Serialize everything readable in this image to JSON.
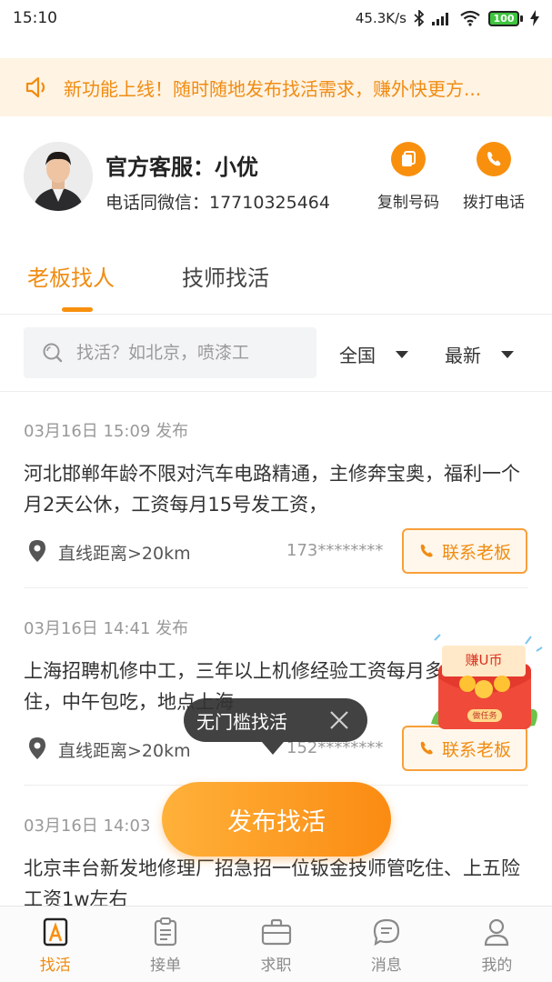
{
  "status_bar": {
    "time": "15:10",
    "net_speed": "45.3K/s",
    "battery": "100"
  },
  "notice": {
    "text": "新功能上线！随时随地发布找活需求，赚外快更方..."
  },
  "service": {
    "name": "官方客服：小优",
    "phone": "电话同微信：17710325464",
    "copy_label": "复制号码",
    "call_label": "拨打电话"
  },
  "tabs": [
    {
      "label": "老板找人",
      "active": true
    },
    {
      "label": "技师找活",
      "active": false
    }
  ],
  "search": {
    "placeholder": "找活？如北京，喷漆工",
    "region": "全国",
    "sort": "最新"
  },
  "jobs": [
    {
      "time": "03月16日 15:09 发布",
      "desc": "河北邯郸年龄不限对汽车电路精通，主修奔宝奥，福利一个月2天公休，工资每月15号发工资，",
      "distance": "直线距离>20km",
      "phone": "173********",
      "contact": "联系老板"
    },
    {
      "time": "03月16日 14:41 发布",
      "desc": "上海招聘机修中工，三年以上机修经验工资每月多6500包住，中午包吃，地点上海",
      "distance": "直线距离>20km",
      "phone": "152********",
      "contact": "联系老板"
    },
    {
      "time": "03月16日 14:03",
      "desc": "北京丰台新发地修理厂招急招一位钣金技师管吃住、上五险工资1w左右"
    }
  ],
  "tooltip": {
    "text": "无门槛找活"
  },
  "publish": {
    "label": "发布找活"
  },
  "reward": {
    "title": "赚U币",
    "sub": "做任务"
  },
  "nav": [
    {
      "label": "找活",
      "icon": "find-work-icon",
      "active": true
    },
    {
      "label": "接单",
      "icon": "order-icon",
      "active": false
    },
    {
      "label": "求职",
      "icon": "briefcase-icon",
      "active": false
    },
    {
      "label": "消息",
      "icon": "message-icon",
      "active": false
    },
    {
      "label": "我的",
      "icon": "profile-icon",
      "active": false
    }
  ],
  "colors": {
    "accent": "#f8900e",
    "notice_bg": "#fff3e3",
    "contact_bg": "#fff7ec"
  }
}
